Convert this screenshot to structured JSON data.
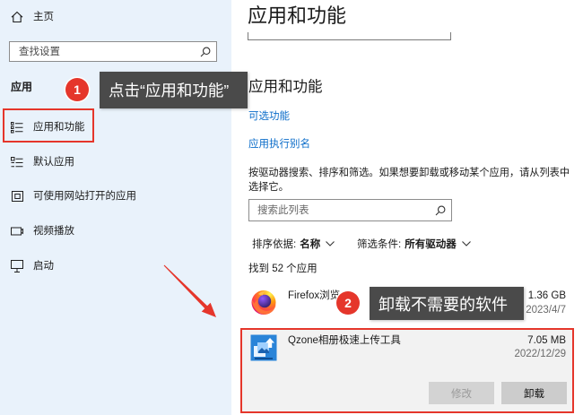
{
  "sidebar": {
    "home_label": "主页",
    "home_icon": "home-icon",
    "search_placeholder": "查找设置",
    "section_heading": "应用",
    "items": [
      {
        "label": "应用和功能",
        "icon": "apps-features-icon"
      },
      {
        "label": "默认应用",
        "icon": "default-apps-icon"
      },
      {
        "label": "可使用网站打开的应用",
        "icon": "apps-for-websites-icon"
      },
      {
        "label": "视频播放",
        "icon": "video-playback-icon"
      },
      {
        "label": "启动",
        "icon": "startup-icon"
      }
    ]
  },
  "main": {
    "page_title": "应用和功能",
    "section_title": "应用和功能",
    "links": [
      {
        "label": "可选功能"
      },
      {
        "label": "应用执行别名"
      }
    ],
    "description": "按驱动器搜索、排序和筛选。如果想要卸载或移动某个应用，请从列表中选择它。",
    "search_placeholder": "搜索此列表",
    "sort": {
      "label": "排序依据:",
      "value": "名称"
    },
    "filter": {
      "label": "筛选条件:",
      "value": "所有驱动器"
    },
    "count_text": "找到 52 个应用",
    "apps": [
      {
        "name": "Firefox浏览",
        "size": "1.36 GB",
        "date": "2023/4/7",
        "icon": "firefox-icon",
        "selected": false
      },
      {
        "name": "Qzone相册极速上传工具",
        "size": "7.05 MB",
        "date": "2022/12/29",
        "icon": "qzone-uploader-icon",
        "selected": true
      }
    ],
    "actions": {
      "modify_label": "修改",
      "modify_enabled": false,
      "uninstall_label": "卸载",
      "uninstall_enabled": true
    }
  },
  "annotations": [
    {
      "number": "1",
      "text": "点击“应用和功能”"
    },
    {
      "number": "2",
      "text": "卸载不需要的软件"
    }
  ],
  "colors": {
    "sidebar_bg": "#e9f2fb",
    "link": "#0a6cc9",
    "annotation_red": "#e5362b",
    "tooltip_bg": "#4a4a4a",
    "selected_row_bg": "#f2f2f2"
  }
}
